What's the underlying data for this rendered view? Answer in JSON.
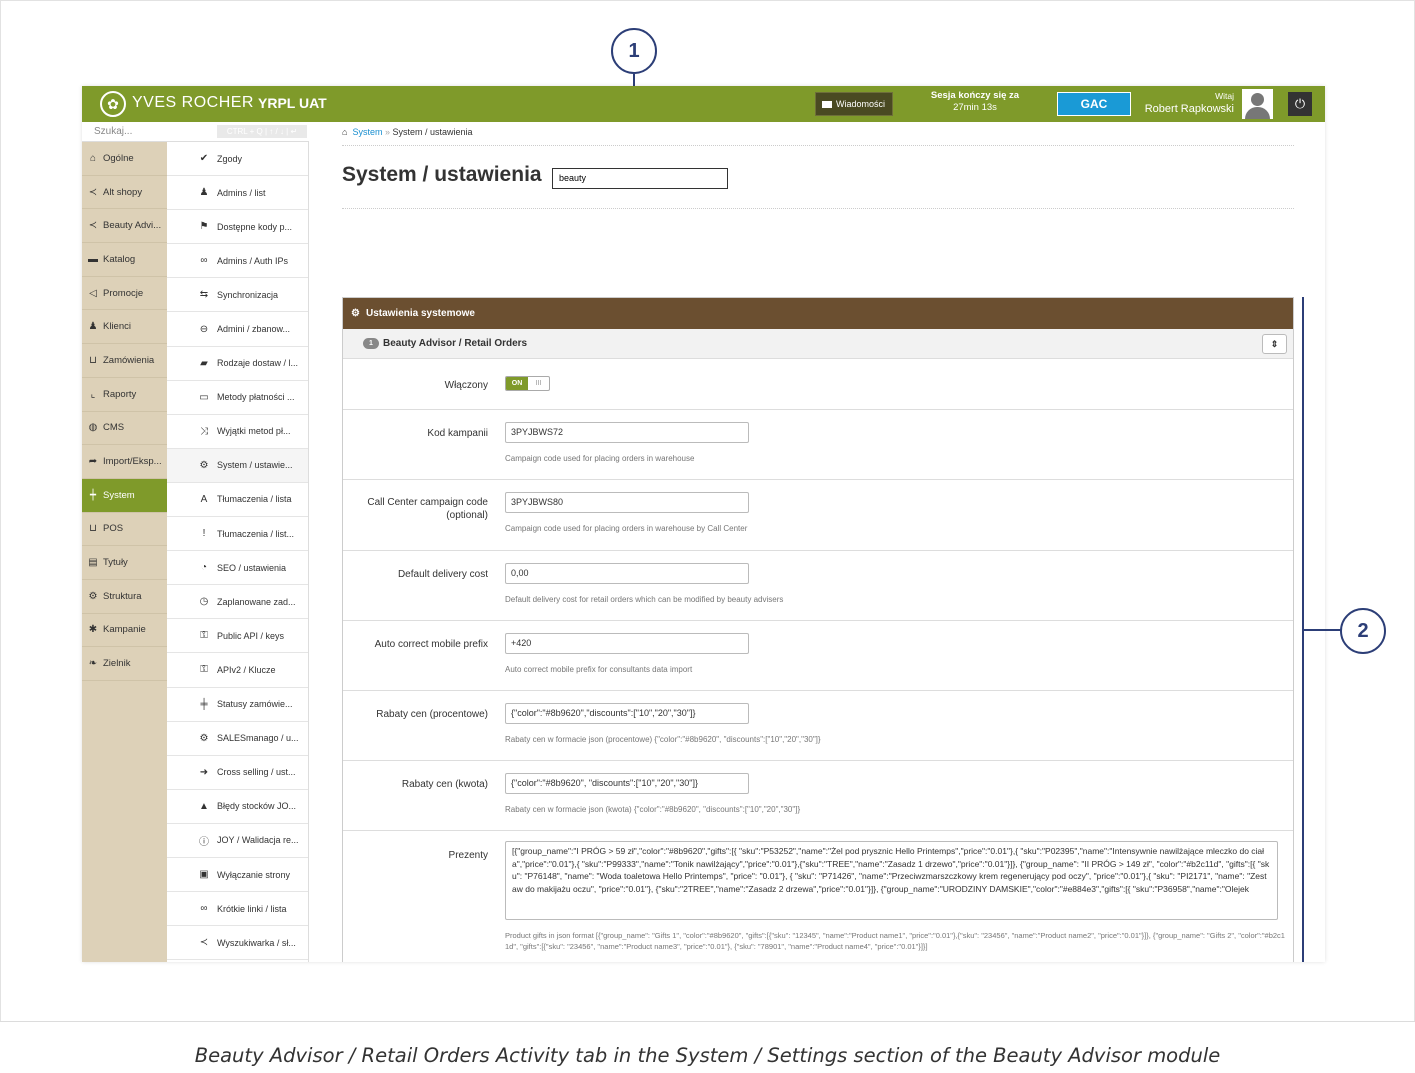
{
  "header": {
    "brand": "YVES ROCHER",
    "env": "YRPL UAT",
    "messages_label": "Wiadomości",
    "session_label": "Sesja kończy się za",
    "session_time": "27min 13s",
    "gac_label": "GAC",
    "welcome_small": "Witaj",
    "user_name": "Robert Rapkowski"
  },
  "search": {
    "placeholder": "Szukaj...",
    "shortcut_hint": "CTRL + Q | ↑ / ↓ | ↵"
  },
  "nav_main": [
    {
      "label": "Ogólne",
      "icon": "home-icon"
    },
    {
      "label": "Alt shopy",
      "icon": "share-icon"
    },
    {
      "label": "Beauty Advi...",
      "icon": "share-icon"
    },
    {
      "label": "Katalog",
      "icon": "folder-icon"
    },
    {
      "label": "Promocje",
      "icon": "bullhorn-icon"
    },
    {
      "label": "Klienci",
      "icon": "users-icon"
    },
    {
      "label": "Zamówienia",
      "icon": "cart-icon"
    },
    {
      "label": "Raporty",
      "icon": "chart-icon"
    },
    {
      "label": "CMS",
      "icon": "globe-icon"
    },
    {
      "label": "Import/Eksp...",
      "icon": "arrow-icon"
    },
    {
      "label": "System",
      "icon": "sliders-icon",
      "active": true
    },
    {
      "label": "POS",
      "icon": "cart-icon"
    },
    {
      "label": "Tytuły",
      "icon": "titles-icon"
    },
    {
      "label": "Struktura",
      "icon": "gears-icon"
    },
    {
      "label": "Kampanie",
      "icon": "asterisk-icon"
    },
    {
      "label": "Zielnik",
      "icon": "leaf-icon"
    }
  ],
  "nav_sub": [
    {
      "label": "Zgody",
      "icon": "check-icon"
    },
    {
      "label": "Admins / list",
      "icon": "admin-icon"
    },
    {
      "label": "Dostępne kody p...",
      "icon": "flag-icon"
    },
    {
      "label": "Admins / Auth IPs",
      "icon": "link-icon"
    },
    {
      "label": "Synchronizacja",
      "icon": "sync-icon"
    },
    {
      "label": "Admini / zbanow...",
      "icon": "ban-icon"
    },
    {
      "label": "Rodzaje dostaw / l...",
      "icon": "truck-icon"
    },
    {
      "label": "Metody płatności ...",
      "icon": "card-icon"
    },
    {
      "label": "Wyjątki metod pł...",
      "icon": "shuffle-icon"
    },
    {
      "label": "System / ustawie...",
      "icon": "gear-icon",
      "active": true
    },
    {
      "label": "Tłumaczenia / lista",
      "icon": "font-icon"
    },
    {
      "label": "Tłumaczenia / list...",
      "icon": "exclamation-icon"
    },
    {
      "label": "SEO / ustawienia",
      "icon": "dashboard-icon"
    },
    {
      "label": "Zaplanowane zad...",
      "icon": "clock-icon"
    },
    {
      "label": "Public API / keys",
      "icon": "key-icon"
    },
    {
      "label": "APIv2 / Klucze",
      "icon": "key-icon"
    },
    {
      "label": "Statusy zamówie...",
      "icon": "status-icon"
    },
    {
      "label": "SALESmanago / u...",
      "icon": "gear-icon"
    },
    {
      "label": "Cross selling / ust...",
      "icon": "arrow-right-icon"
    },
    {
      "label": "Błędy stocków JO...",
      "icon": "warning-icon"
    },
    {
      "label": "JOY / Walidacja re...",
      "icon": "info-icon"
    },
    {
      "label": "Wyłączanie strony",
      "icon": "lock-icon"
    },
    {
      "label": "Krótkie linki / lista",
      "icon": "link-icon"
    },
    {
      "label": "Wyszukiwarka / sł...",
      "icon": "share-icon"
    }
  ],
  "breadcrumb": {
    "root": "System",
    "separator": "»",
    "current": "System / ustawienia"
  },
  "page": {
    "title": "System / ustawienia",
    "filter_value": "beauty"
  },
  "panel": {
    "title": "Ustawienia systemowe",
    "tab_badge": "1",
    "tab_label": "Beauty Advisor / Retail Orders"
  },
  "form": {
    "enabled_label": "Włączony",
    "enabled_on": "ON",
    "enabled_off": "III",
    "campaign_code_label": "Kod kampanii",
    "campaign_code_value": "3PYJBWS72",
    "campaign_code_hint": "Campaign code used for placing orders in warehouse",
    "callcenter_label": "Call Center campaign code (optional)",
    "callcenter_value": "3PYJBWS80",
    "callcenter_hint": "Campaign code used for placing orders in warehouse by Call Center",
    "delivery_label": "Default delivery cost",
    "delivery_value": "0,00",
    "delivery_hint": "Default delivery cost for retail orders which can be modified by beauty advisers",
    "prefix_label": "Auto correct mobile prefix",
    "prefix_value": "+420",
    "prefix_hint": "Auto correct mobile prefix for consultants data import",
    "discount_pct_label": "Rabaty cen (procentowe)",
    "discount_pct_value": "{\"color\":\"#8b9620\",\"discounts\":[\"10\",\"20\",\"30\"]}",
    "discount_pct_hint": "Rabaty cen w formacie json (procentowe) {\"color\":\"#8b9620\", \"discounts\":[\"10\",\"20\",\"30\"]}",
    "discount_amt_label": "Rabaty cen (kwota)",
    "discount_amt_value": "{\"color\":\"#8b9620\", \"discounts\":[\"10\",\"20\",\"30\"]}",
    "discount_amt_hint": "Rabaty cen w formacie json (kwota) {\"color\":\"#8b9620\", \"discounts\":[\"10\",\"20\",\"30\"]}",
    "gifts_label": "Prezenty",
    "gifts_value": "[{\"group_name\":\"I PRÓG > 59 zł\",\"color\":\"#8b9620\",\"gifts\":[{ \"sku\":\"P53252\",\"name\":\"Żel pod prysznic Hello Printemps\",\"price\":\"0.01\"},{ \"sku\":\"P02395\",\"name\":\"Intensywnie nawilżające mleczko do ciała\",\"price\":\"0.01\"},{ \"sku\":\"P99333\",\"name\":\"Tonik nawilżający\",\"price\":\"0.01\"},{\"sku\":\"TREE\",\"name\":\"Zasadz 1 drzewo\",\"price\":\"0.01\"}]}, {\"group_name\": \"II PRÓG > 149 zł\", \"color\":\"#b2c11d\", \"gifts\":[{ \"sku\": \"P76148\", \"name\": \"Woda toaletowa Hello Printemps\", \"price\": \"0.01\"}, { \"sku\": \"P71426\", \"name\":\"Przeciwzmarszczkowy krem regenerujący pod oczy\", \"price\":\"0.01\"},{ \"sku\": \"PI2171\", \"name\": \"Zestaw do makijażu oczu\", \"price\":\"0.01\"}, {\"sku\":\"2TREE\",\"name\":\"Zasadz 2 drzewa\",\"price\":\"0.01\"}]}, {\"group_name\":\"URODZINY DAMSKIE\",\"color\":\"#e884e3\",\"gifts\":[{ \"sku\":\"P36958\",\"name\":\"Olejek",
    "gifts_hint": "Product gifts in json format [{\"group_name\": \"Gifts 1\", \"color\":\"#8b9620\", \"gifts\":[{\"sku\": \"12345\", \"name\":\"Product name1\", \"price\":\"0.01\"},{\"sku\": \"23456\", \"name\":\"Product name2\", \"price\":\"0.01\"}]}, {\"group_name\": \"Gifts 2\", \"color\":\"#b2c11d\", \"gifts\":[{\"sku\": \"23456\", \"name\":\"Product name3\", \"price\":\"0.01\"}, {\"sku\": \"78901\", \"name\":\"Product name4\", \"price\":\"0.01\"}]}]"
  },
  "callouts": [
    "1",
    "2"
  ],
  "caption": "Beauty Advisor / Retail Orders Activity tab in the System / Settings section of the Beauty Advisor module",
  "colors": {
    "topbar": "#7f9a2a",
    "panel_header": "#6b4f30",
    "sidebar": "#ddd1b8",
    "gac": "#1a9ad6",
    "callout": "#2c3e77"
  }
}
